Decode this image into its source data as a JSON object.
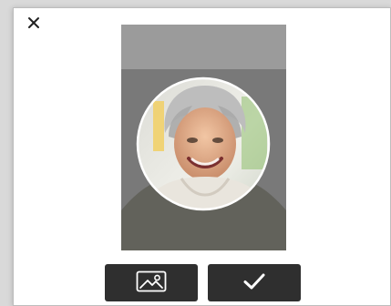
{
  "dialog": {
    "close_icon": "close-icon",
    "image_icon": "image-icon",
    "check_icon": "checkmark-icon",
    "colors": {
      "button_bg": "#2f2f2f",
      "overlay_bg": "#7d7d7d",
      "crop_circle": "#ffffff"
    }
  }
}
